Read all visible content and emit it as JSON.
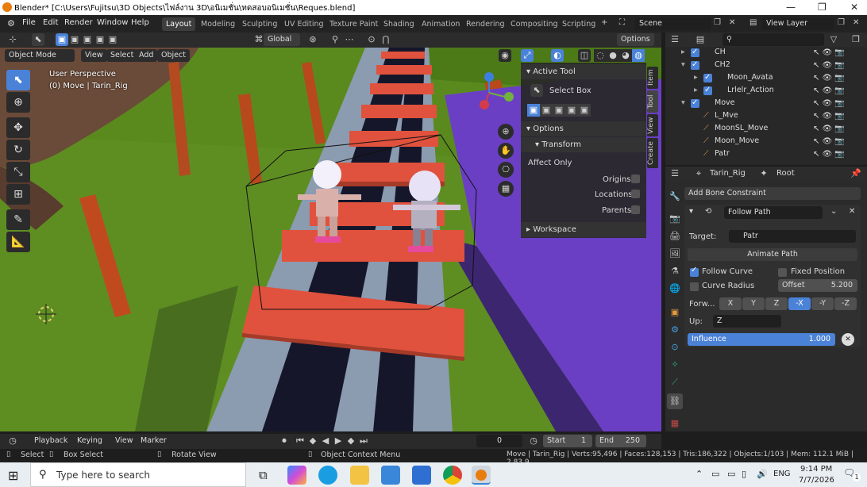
{
  "window": {
    "title": "Blender* [C:\\Users\\Fujitsu\\3D Objects\\ไฟล์งาน 3D\\อนิเมชั่น\\ทดสอบอนิเมชั่น\\Reques.blend]"
  },
  "menu": [
    "File",
    "Edit",
    "Render",
    "Window",
    "Help"
  ],
  "workspaces": [
    "Layout",
    "Modeling",
    "Sculpting",
    "UV Editing",
    "Texture Paint",
    "Shading",
    "Animation",
    "Rendering",
    "Compositing",
    "Scripting"
  ],
  "active_workspace": "Layout",
  "scene": {
    "name": "Scene",
    "view_layer": "View Layer"
  },
  "header": {
    "orientation": "Global",
    "options": "Options",
    "mode": "Object Mode",
    "menus": [
      "View",
      "Select",
      "Add",
      "Object"
    ]
  },
  "viewport": {
    "perspective": "User Perspective",
    "selection": "(0) Move | Tarin_Rig"
  },
  "npanel": {
    "active_tool_title": "Active Tool",
    "tool_name": "Select Box",
    "options_title": "Options",
    "transform_title": "Transform",
    "affect_only": "Affect Only",
    "affect_items": [
      "Origins",
      "Locations",
      "Parents"
    ],
    "workspace_title": "Workspace",
    "tabs": [
      "Item",
      "Tool",
      "View",
      "Create"
    ]
  },
  "outliner": {
    "rows": [
      "CH",
      "CH2",
      "Moon_Avata",
      "Lrlelr_Action",
      "Move",
      "L_Mve",
      "MoonSL_Move",
      "Moon_Move",
      "Patr"
    ]
  },
  "properties": {
    "object": "Tarin_Rig",
    "bone": "Root",
    "add_constraint": "Add Bone Constraint",
    "constraint_name": "Follow Path",
    "target_label": "Target:",
    "target_value": "Patr",
    "animate_path": "Animate Path",
    "follow_curve": "Follow Curve",
    "fixed_position": "Fixed Position",
    "curve_radius": "Curve Radius",
    "offset_label": "Offset",
    "offset_value": "5.200",
    "forward_label": "Forw...",
    "forward_axes": [
      "X",
      "Y",
      "Z",
      "-X",
      "-Y",
      "-Z"
    ],
    "forward_selected": "-X",
    "up_label": "Up:",
    "up_value": "Z",
    "influence_label": "Influence",
    "influence_value": "1.000"
  },
  "timeline": {
    "menus": [
      "Playback",
      "Keying",
      "View",
      "Marker"
    ],
    "frame": "0",
    "start_label": "Start",
    "start": "1",
    "end_label": "End",
    "end": "250"
  },
  "status": {
    "select": "Select",
    "box_select": "Box Select",
    "rotate_view": "Rotate View",
    "context_menu": "Object Context Menu",
    "stats": "Move | Tarin_Rig | Verts:95,496 | Faces:128,153 | Tris:186,322 | Objects:1/103 | Mem: 112.1 MiB | 2.83.9"
  },
  "taskbar": {
    "search_placeholder": "Type here to search",
    "lang": "ENG",
    "time": "9:14 PM",
    "date": "7/7/2026",
    "notif": "1"
  },
  "colors": {
    "accent": "#4a82d8",
    "grass": "#5b8a1e",
    "track_red": "#e0523d",
    "track_purple": "#6a3fc4"
  }
}
